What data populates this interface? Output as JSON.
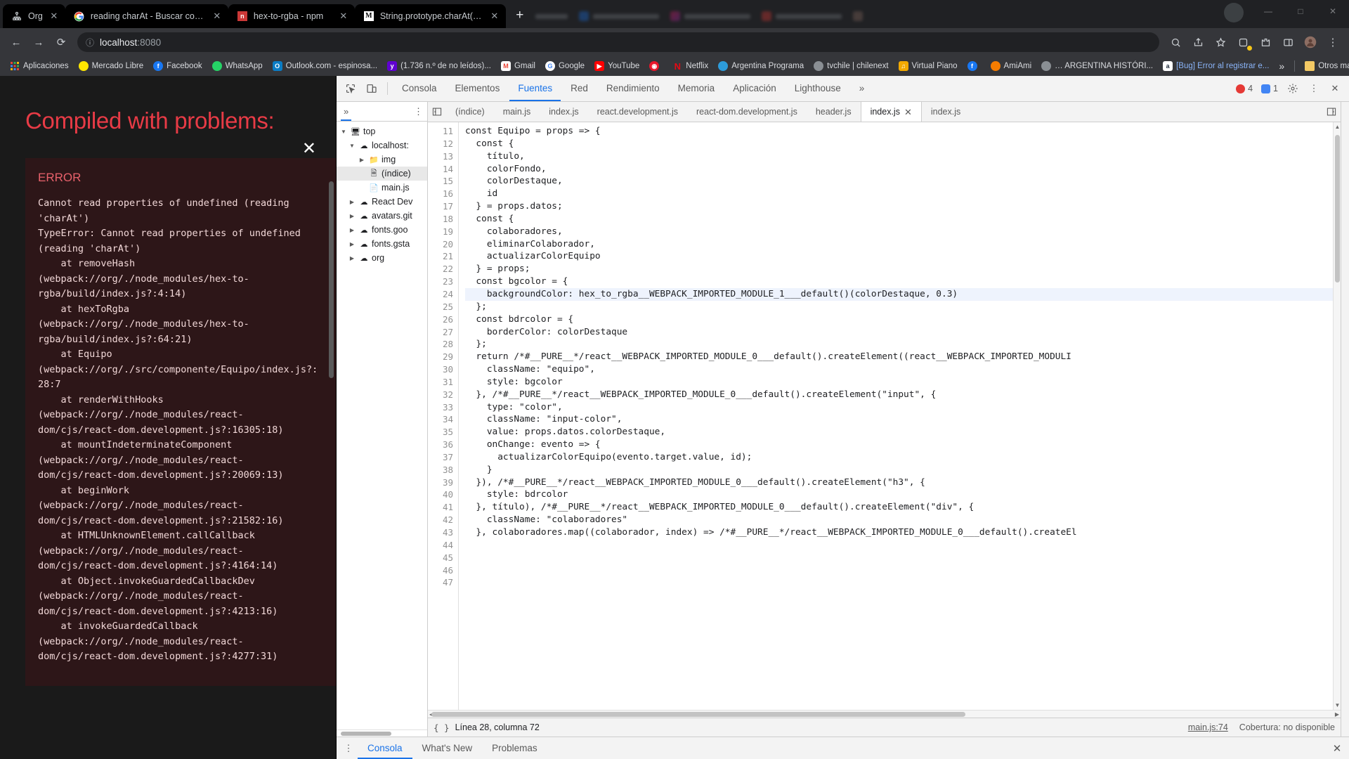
{
  "browser": {
    "tabs": [
      {
        "title": "Org",
        "favicon": "sitemap-icon",
        "active": false,
        "group": true
      },
      {
        "title": "reading charAt - Buscar con Google",
        "favicon": "google-icon",
        "active": false,
        "group": true
      },
      {
        "title": "hex-to-rgba - npm",
        "favicon": "npm-icon",
        "active": false,
        "group": true
      },
      {
        "title": "String.prototype.charAt() - JavaScript | M",
        "favicon": "mdn-icon",
        "active": false,
        "group": true
      }
    ],
    "new_tab_label": "+",
    "window_controls": [
      "—",
      "□",
      "✕"
    ],
    "profile_initial": "",
    "nav": {
      "back": "←",
      "forward": "→",
      "reload": "⟳",
      "info_icon": "info-icon",
      "url_host": "localhost",
      "url_port": ":8080",
      "zoom_icon": "zoom-icon",
      "share_icon": "share-icon",
      "star_icon": "star-icon",
      "extension_icon": "extension-icon",
      "puzzle_icon": "puzzle-icon",
      "split_icon": "split-icon",
      "profile_icon": "profile-icon",
      "menu_icon": "menu-icon"
    },
    "bookmarks": [
      {
        "label": "Aplicaciones",
        "icon": "apps-grid-icon",
        "color": "#4285f4"
      },
      {
        "label": "Mercado Libre",
        "icon": "mercadolibre-icon",
        "color": "#ffe600"
      },
      {
        "label": "Facebook",
        "icon": "facebook-icon",
        "color": "#1877f2"
      },
      {
        "label": "WhatsApp",
        "icon": "whatsapp-icon",
        "color": "#25d366"
      },
      {
        "label": "Outlook.com - espinosa...",
        "icon": "outlook-icon",
        "color": "#0a7cc4"
      },
      {
        "label": "(1.736 n.º de no leídos)...",
        "icon": "yahoo-icon",
        "color": "#6001d2"
      },
      {
        "label": "Gmail",
        "icon": "gmail-icon",
        "color": "#ea4335"
      },
      {
        "label": "Google",
        "icon": "google-icon",
        "color": "#4285f4"
      },
      {
        "label": "YouTube",
        "icon": "youtube-icon",
        "color": "#ff0000"
      },
      {
        "label": "",
        "icon": "rec-icon",
        "color": "#e8172b"
      },
      {
        "label": "Netflix",
        "icon": "netflix-icon",
        "color": "#e50914"
      },
      {
        "label": "Argentina Programa",
        "icon": "argentina-icon",
        "color": "#2d9cdb"
      },
      {
        "label": "tvchile | chilenext",
        "icon": "globe-icon",
        "color": "#8a8f94"
      },
      {
        "label": "Virtual Piano",
        "icon": "piano-icon",
        "color": "#f2a900"
      },
      {
        "label": "",
        "icon": "facebook-icon",
        "color": "#1877f2"
      },
      {
        "label": "AmiAmi",
        "icon": "amiami-icon",
        "color": "#f57c00"
      },
      {
        "label": "… ARGENTINA HISTÓRI...",
        "icon": "globe-icon",
        "color": "#8a8f94"
      },
      {
        "label": "[Bug] Error al registrar e...",
        "icon": "amazon-icon",
        "color": "#232f3e"
      }
    ],
    "bookmarks_overflow": "»",
    "other_bookmarks": {
      "label": "Otros marcadores",
      "icon": "folder-icon"
    }
  },
  "error_overlay": {
    "close_label": "✕",
    "title": "Compiled with problems:",
    "error_label": "ERROR",
    "message": "Cannot read properties of undefined (reading 'charAt')\nTypeError: Cannot read properties of undefined (reading 'charAt')\n    at removeHash (webpack://org/./node_modules/hex-to-rgba/build/index.js?:4:14)\n    at hexToRgba (webpack://org/./node_modules/hex-to-rgba/build/index.js?:64:21)\n    at Equipo (webpack://org/./src/componente/Equipo/index.js?:28:7\n    at renderWithHooks (webpack://org/./node_modules/react-dom/cjs/react-dom.development.js?:16305:18)\n    at mountIndeterminateComponent (webpack://org/./node_modules/react-dom/cjs/react-dom.development.js?:20069:13)\n    at beginWork (webpack://org/./node_modules/react-dom/cjs/react-dom.development.js?:21582:16)\n    at HTMLUnknownElement.callCallback (webpack://org/./node_modules/react-dom/cjs/react-dom.development.js?:4164:14)\n    at Object.invokeGuardedCallbackDev (webpack://org/./node_modules/react-dom/cjs/react-dom.development.js?:4213:16)\n    at invokeGuardedCallback (webpack://org/./node_modules/react-dom/cjs/react-dom.development.js?:4277:31)"
  },
  "devtools": {
    "inspect_icon": "inspect-cursor-icon",
    "device_icon": "device-toolbar-icon",
    "panels": [
      {
        "label": "Consola",
        "active": false
      },
      {
        "label": "Elementos",
        "active": false
      },
      {
        "label": "Fuentes",
        "active": true
      },
      {
        "label": "Red",
        "active": false
      },
      {
        "label": "Rendimiento",
        "active": false
      },
      {
        "label": "Memoria",
        "active": false
      },
      {
        "label": "Aplicación",
        "active": false
      },
      {
        "label": "Lighthouse",
        "active": false
      }
    ],
    "panels_overflow": "»",
    "error_count": "4",
    "warning_count": "1",
    "settings_icon": "gear-icon",
    "more_icon": "kebab-menu-icon",
    "close_icon": "close-icon",
    "navigator": {
      "overflow": "»",
      "menu_icon": "kebab-menu-icon",
      "tree": [
        {
          "label": "top",
          "depth": 0,
          "icon": "monitor-icon",
          "arrow": "▼",
          "selected": false
        },
        {
          "label": "localhost:",
          "depth": 1,
          "icon": "cloud-icon",
          "arrow": "▼",
          "selected": false
        },
        {
          "label": "img",
          "depth": 2,
          "icon": "folder-icon",
          "arrow": "▶",
          "selected": false
        },
        {
          "label": "(índice)",
          "depth": 2,
          "icon": "file-icon",
          "arrow": "",
          "selected": true
        },
        {
          "label": "main.js",
          "depth": 2,
          "icon": "script-icon",
          "arrow": "",
          "selected": false
        },
        {
          "label": "React Dev",
          "depth": 1,
          "icon": "cloud-icon",
          "arrow": "▶",
          "selected": false
        },
        {
          "label": "avatars.git",
          "depth": 1,
          "icon": "cloud-icon",
          "arrow": "▶",
          "selected": false
        },
        {
          "label": "fonts.goo",
          "depth": 1,
          "icon": "cloud-icon",
          "arrow": "▶",
          "selected": false
        },
        {
          "label": "fonts.gsta",
          "depth": 1,
          "icon": "cloud-icon",
          "arrow": "▶",
          "selected": false
        },
        {
          "label": "org",
          "depth": 1,
          "icon": "cloud-icon",
          "arrow": "▶",
          "selected": false
        }
      ]
    },
    "file_tabs": {
      "prev_icon": "panel-toggle-icon",
      "next_icon": "panel-toggle-icon",
      "items": [
        {
          "label": "(índice)",
          "active": false,
          "closable": false
        },
        {
          "label": "main.js",
          "active": false,
          "closable": false
        },
        {
          "label": "index.js",
          "active": false,
          "closable": false
        },
        {
          "label": "react.development.js",
          "active": false,
          "closable": false
        },
        {
          "label": "react-dom.development.js",
          "active": false,
          "closable": false
        },
        {
          "label": "header.js",
          "active": false,
          "closable": false
        },
        {
          "label": "index.js",
          "active": true,
          "closable": true
        },
        {
          "label": "index.js",
          "active": false,
          "closable": false
        }
      ]
    },
    "code": {
      "first_line": 11,
      "lines": [
        {
          "n": 11,
          "text": ""
        },
        {
          "n": 12,
          "text": ""
        },
        {
          "n": 13,
          "text": ""
        },
        {
          "n": 14,
          "text": ""
        },
        {
          "n": 15,
          "text": "const Equipo = props => {"
        },
        {
          "n": 16,
          "text": "  const {"
        },
        {
          "n": 17,
          "text": "    título,"
        },
        {
          "n": 18,
          "text": "    colorFondo,"
        },
        {
          "n": 19,
          "text": "    colorDestaque,"
        },
        {
          "n": 20,
          "text": "    id"
        },
        {
          "n": 21,
          "text": "  } = props.datos;"
        },
        {
          "n": 22,
          "text": "  const {"
        },
        {
          "n": 23,
          "text": "    colaboradores,"
        },
        {
          "n": 24,
          "text": "    eliminarColaborador,"
        },
        {
          "n": 25,
          "text": "    actualizarColorEquipo"
        },
        {
          "n": 26,
          "text": "  } = props;"
        },
        {
          "n": 27,
          "text": "  const bgcolor = {"
        },
        {
          "n": 28,
          "text": "    backgroundColor: hex_to_rgba__WEBPACK_IMPORTED_MODULE_1___default()(colorDestaque, 0.3)"
        },
        {
          "n": 29,
          "text": "  };"
        },
        {
          "n": 30,
          "text": "  const bdrcolor = {"
        },
        {
          "n": 31,
          "text": "    borderColor: colorDestaque"
        },
        {
          "n": 32,
          "text": "  };"
        },
        {
          "n": 33,
          "text": "  return /*#__PURE__*/react__WEBPACK_IMPORTED_MODULE_0___default().createElement((react__WEBPACK_IMPORTED_MODULI"
        },
        {
          "n": 34,
          "text": "    className: \"equipo\","
        },
        {
          "n": 35,
          "text": "    style: bgcolor"
        },
        {
          "n": 36,
          "text": "  }, /*#__PURE__*/react__WEBPACK_IMPORTED_MODULE_0___default().createElement(\"input\", {"
        },
        {
          "n": 37,
          "text": "    type: \"color\","
        },
        {
          "n": 38,
          "text": "    className: \"input-color\","
        },
        {
          "n": 39,
          "text": "    value: props.datos.colorDestaque,"
        },
        {
          "n": 40,
          "text": "    onChange: evento => {"
        },
        {
          "n": 41,
          "text": "      actualizarColorEquipo(evento.target.value, id);"
        },
        {
          "n": 42,
          "text": "    }"
        },
        {
          "n": 43,
          "text": "  }), /*#__PURE__*/react__WEBPACK_IMPORTED_MODULE_0___default().createElement(\"h3\", {"
        },
        {
          "n": 44,
          "text": "    style: bdrcolor"
        },
        {
          "n": 45,
          "text": "  }, título), /*#__PURE__*/react__WEBPACK_IMPORTED_MODULE_0___default().createElement(\"div\", {"
        },
        {
          "n": 46,
          "text": "    className: \"colaboradores\""
        },
        {
          "n": 47,
          "text": "  }, colaboradores.map((colaborador, index) => /*#__PURE__*/react__WEBPACK_IMPORTED_MODULE_0___default().createEl"
        }
      ]
    },
    "status": {
      "format_icon": "pretty-print-icon",
      "position": "Línea 28, columna 72",
      "source_link": "main.js:74",
      "coverage": "Cobertura: no disponible"
    },
    "drawer": {
      "menu_icon": "kebab-menu-icon",
      "tabs": [
        {
          "label": "Consola",
          "active": true
        },
        {
          "label": "What's New",
          "active": false
        },
        {
          "label": "Problemas",
          "active": false
        }
      ],
      "close_icon": "close-icon"
    }
  },
  "colors": {
    "accent": "#1a73e8",
    "error_red": "#e83b46",
    "chrome_dark": "#202124",
    "chrome_toolbar": "#35363a"
  }
}
